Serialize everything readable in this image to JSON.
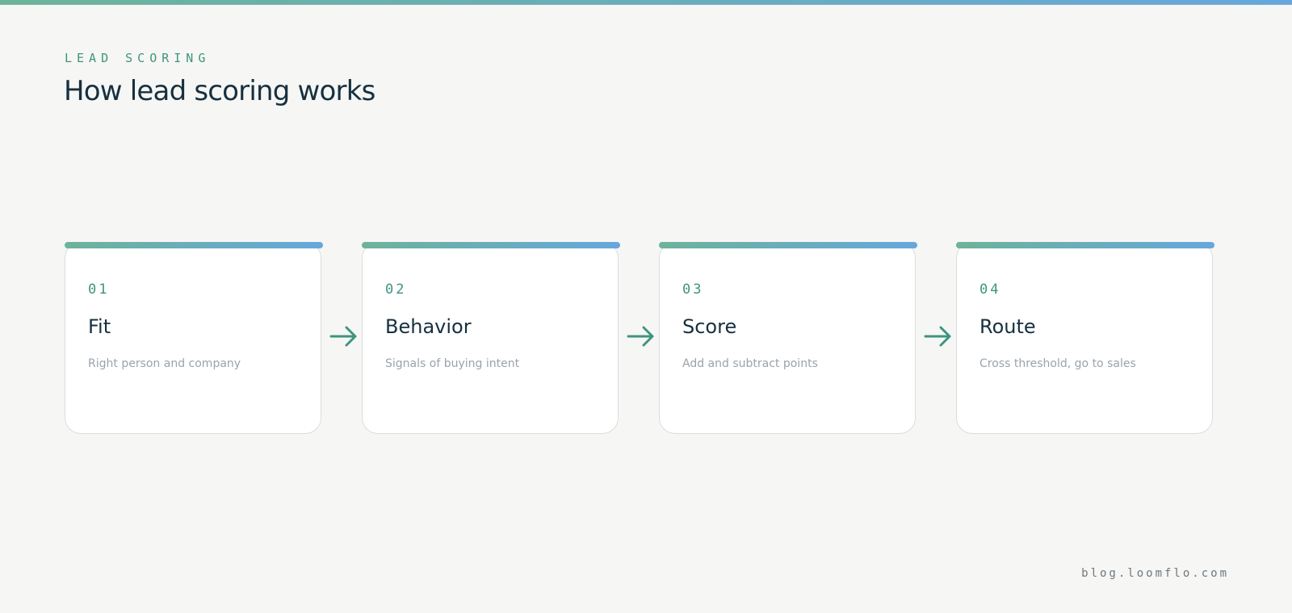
{
  "header": {
    "eyebrow": "LEAD SCORING",
    "title": "How lead scoring works"
  },
  "steps": [
    {
      "number": "01",
      "title": "Fit",
      "description": "Right person and company"
    },
    {
      "number": "02",
      "title": "Behavior",
      "description": "Signals of buying intent"
    },
    {
      "number": "03",
      "title": "Score",
      "description": "Add and subtract points"
    },
    {
      "number": "04",
      "title": "Route",
      "description": "Cross threshold, go to sales"
    }
  ],
  "footer": {
    "site": "blog.loomflo.com"
  },
  "colors": {
    "accent_start": "#6cb39a",
    "accent_end": "#67a7dc",
    "accent_text": "#3f9480",
    "heading": "#163040",
    "muted": "#9aa3ab",
    "background": "#f6f6f4"
  },
  "icons": {
    "connector": "arrow-right-icon"
  }
}
